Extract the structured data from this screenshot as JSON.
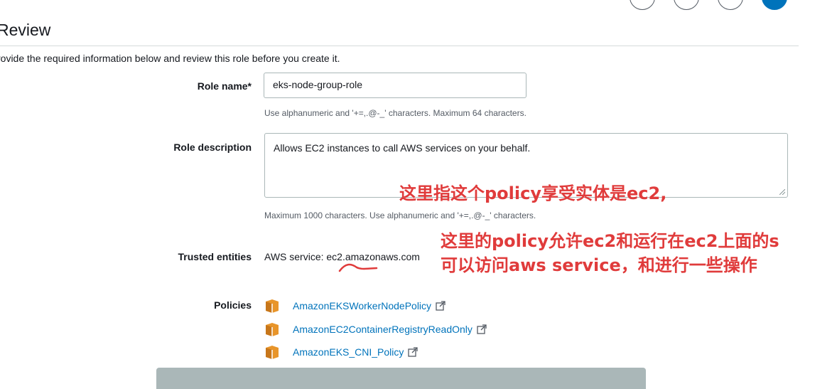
{
  "page": {
    "title": "Review",
    "intro": "rovide the required information below and review this role before you create it."
  },
  "role_name": {
    "label": "Role name*",
    "value": "eks-node-group-role",
    "hint": "Use alphanumeric and '+=,.@-_' characters. Maximum 64 characters."
  },
  "role_description": {
    "label": "Role description",
    "value": "Allows EC2 instances to call AWS services on your behalf.",
    "hint": "Maximum 1000 characters. Use alphanumeric and '+=,.@-_' characters."
  },
  "trusted_entities": {
    "label": "Trusted entities",
    "value": "AWS service: ec2.amazonaws.com"
  },
  "policies": {
    "label": "Policies",
    "items": [
      {
        "name": "AmazonEKSWorkerNodePolicy",
        "icon": "policy-box-icon"
      },
      {
        "name": "AmazonEC2ContainerRegistryReadOnly",
        "icon": "policy-box-icon"
      },
      {
        "name": "AmazonEKS_CNI_Policy",
        "icon": "policy-box-icon"
      }
    ]
  },
  "annotations": {
    "note1": "这里指这个policy享受实体是ec2,",
    "note2_line1": "这里的policy允许ec2和运行在ec2上面的s",
    "note2_line2": "可以访问aws service，和进行一些操作"
  },
  "colors": {
    "link": "#0073bb",
    "annotation": "#e03b3b",
    "policy_icon": "#e8952a"
  }
}
